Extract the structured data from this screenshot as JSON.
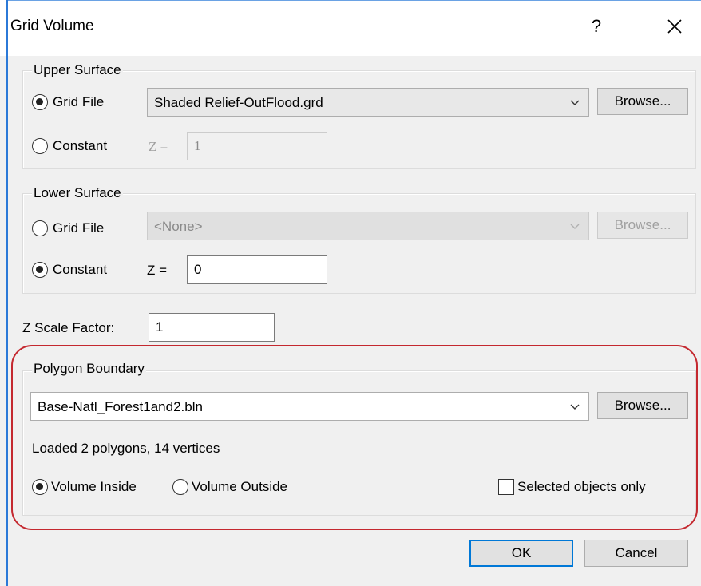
{
  "dialog": {
    "title": "Grid Volume",
    "help_label": "?",
    "accent_color": "#0078d7",
    "highlight_color": "#c4282f"
  },
  "upper": {
    "legend": "Upper Surface",
    "grid_file_label": "Grid File",
    "grid_file_value": "Shaded Relief-OutFlood.grd",
    "browse_label": "Browse...",
    "constant_label": "Constant",
    "z_label": "Z =",
    "z_value": "1",
    "selected": "grid_file"
  },
  "lower": {
    "legend": "Lower Surface",
    "grid_file_label": "Grid File",
    "grid_file_value": "<None>",
    "browse_label": "Browse...",
    "constant_label": "Constant",
    "z_label": "Z =",
    "z_value": "0",
    "selected": "constant"
  },
  "scale": {
    "label": "Z Scale Factor:",
    "value": "1"
  },
  "polygon": {
    "legend": "Polygon Boundary",
    "file_value": "Base-Natl_Forest1and2.bln",
    "browse_label": "Browse...",
    "status": "Loaded 2 polygons, 14 vertices",
    "inside_label": "Volume Inside",
    "outside_label": "Volume Outside",
    "selected": "inside",
    "selected_only_label": "Selected objects only",
    "selected_only_checked": false
  },
  "footer": {
    "ok_label": "OK",
    "cancel_label": "Cancel"
  }
}
